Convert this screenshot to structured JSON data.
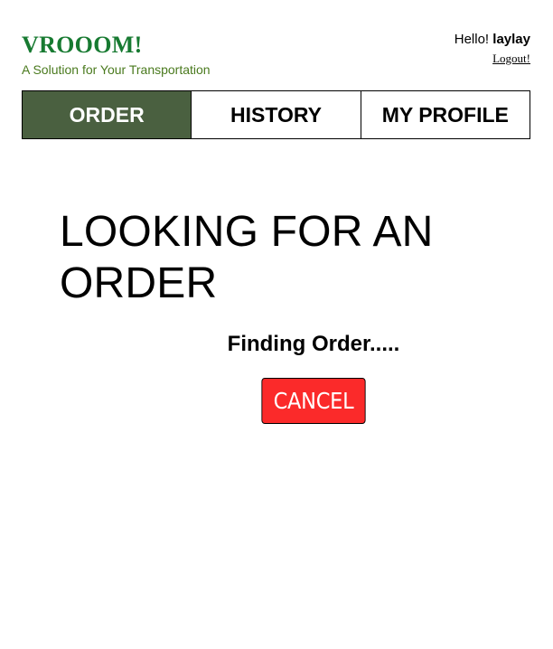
{
  "brand": {
    "title": "VROOOM!",
    "tagline": "A Solution for Your Transportation"
  },
  "user": {
    "greeting": "Hello!",
    "username": "laylay",
    "logout_label": "Logout!"
  },
  "nav": {
    "tabs": [
      {
        "label": "ORDER",
        "active": true
      },
      {
        "label": "HISTORY",
        "active": false
      },
      {
        "label": "MY PROFILE",
        "active": false
      }
    ]
  },
  "main": {
    "heading": "LOOKING FOR AN ORDER",
    "status": "Finding Order.....",
    "cancel_label": "CANCEL"
  },
  "colors": {
    "brand_title": "#177a31",
    "brand_tagline": "#4a7a1e",
    "active_tab_bg": "#4a6040",
    "cancel_bg": "#fb2a2a"
  }
}
